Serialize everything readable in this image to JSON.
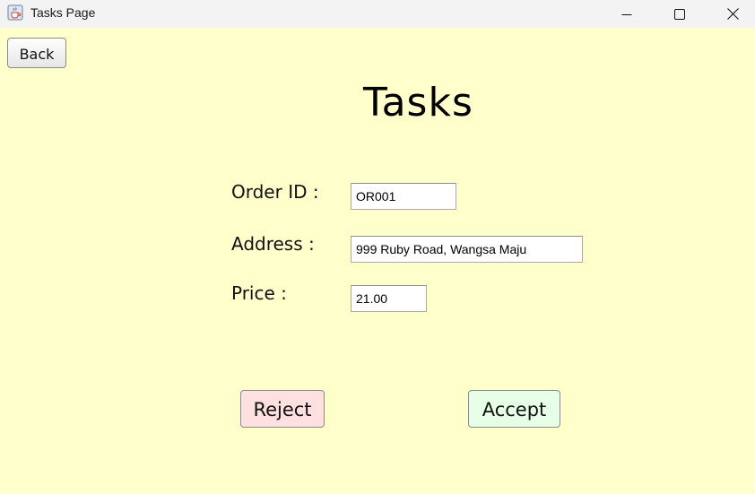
{
  "window": {
    "title": "Tasks Page",
    "icon": "java-cup-icon"
  },
  "toolbar": {
    "back_label": "Back"
  },
  "page": {
    "title": "Tasks"
  },
  "form": {
    "order_id": {
      "label": "Order ID :",
      "value": "OR001"
    },
    "address": {
      "label": "Address :",
      "value": "999 Ruby Road, Wangsa Maju"
    },
    "price": {
      "label": "Price :",
      "value": "21.00"
    }
  },
  "actions": {
    "reject_label": "Reject",
    "accept_label": "Accept"
  },
  "colors": {
    "background": "#ffffcc",
    "reject_bg": "#ffe0e0",
    "accept_bg": "#e6ffe6"
  }
}
